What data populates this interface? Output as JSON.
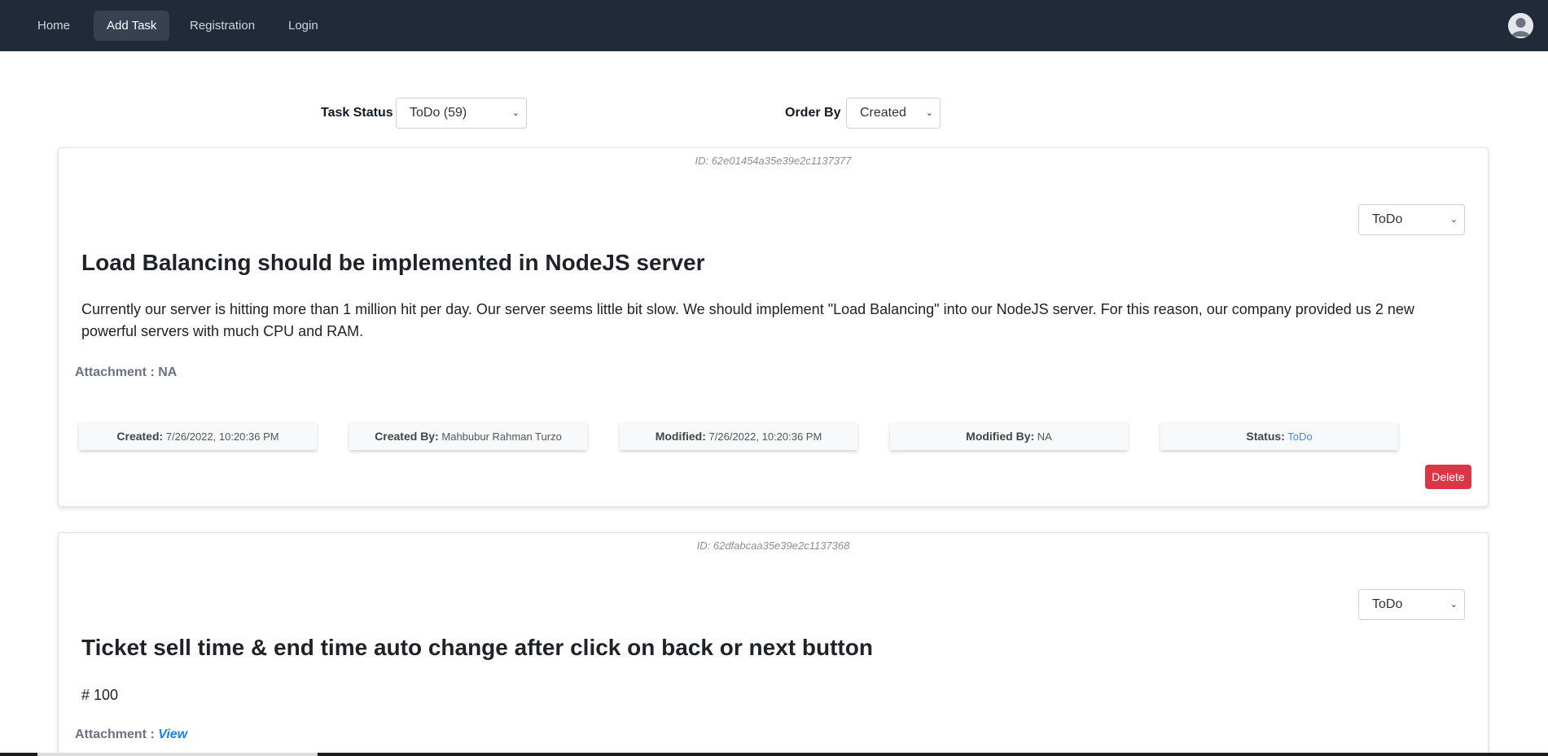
{
  "nav": {
    "items": [
      {
        "label": "Home"
      },
      {
        "label": "Add Task"
      },
      {
        "label": "Registration"
      },
      {
        "label": "Login"
      }
    ],
    "avatar_icon": "user-avatar-icon"
  },
  "filters": {
    "task_status_label": "Task Status",
    "task_status_value": "ToDo (59)",
    "order_by_label": "Order By",
    "order_by_value": "Created"
  },
  "tasks": [
    {
      "id": "ID: 62e01454a35e39e2c1137377",
      "status_select": "ToDo",
      "title": "Load Balancing should be implemented in NodeJS server",
      "description": "Currently our server is hitting more than 1 million hit per day. Our server seems little bit slow. We should implement \"Load Balancing\" into our NodeJS server. For this reason, our company provided us 2 new powerful servers with much CPU and RAM.",
      "attachment_label": "Attachment :",
      "attachment_value": "NA",
      "created_label": "Created:",
      "created_value": "7/26/2022, 10:20:36 PM",
      "created_by_label": "Created By:",
      "created_by_value": "Mahbubur Rahman Turzo",
      "modified_label": "Modified:",
      "modified_value": "7/26/2022, 10:20:36 PM",
      "modified_by_label": "Modified By:",
      "modified_by_value": "NA",
      "status_label": "Status:",
      "status_value": "ToDo",
      "delete_label": "Delete"
    },
    {
      "id": "ID: 62dfabcaa35e39e2c1137368",
      "status_select": "ToDo",
      "title": "Ticket sell time & end time auto change after click on back or next button",
      "description": "# 100",
      "attachment_label": "Attachment :",
      "attachment_value": "View"
    }
  ],
  "colors": {
    "navbar": "#212a39",
    "delete": "#dc3545",
    "link": "#1a7fe6"
  }
}
